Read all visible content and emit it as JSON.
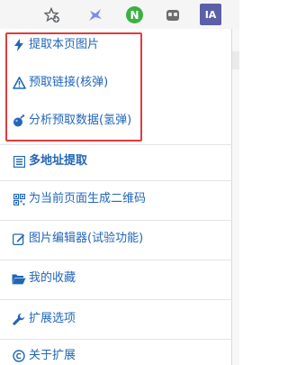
{
  "toolbar": {
    "extensions": [
      {
        "icon": "bookmark-add-icon"
      },
      {
        "icon": "extension-bird-icon",
        "color": "#7c8cf0"
      },
      {
        "icon": "n-extension-icon",
        "label": "N",
        "color": "#3cb043"
      },
      {
        "icon": "gamepad-extension-icon"
      },
      {
        "icon": "ia-extension-icon",
        "label": "IA",
        "color": "#5b5fa8"
      }
    ]
  },
  "menu": {
    "highlight_color": "#e23b3b",
    "link_color": "#2266b8",
    "items": [
      {
        "icon": "lightning-icon",
        "label": "提取本页图片"
      },
      {
        "icon": "warning-triangle-icon",
        "label": "预取链接(核弹)"
      },
      {
        "icon": "bomb-icon",
        "label": "分析预取数据(氢弹)"
      },
      {
        "icon": "list-icon",
        "label": "多地址提取"
      },
      {
        "icon": "qrcode-icon",
        "label": "为当前页面生成二维码"
      },
      {
        "icon": "edit-icon",
        "label": "图片编辑器(试验功能)"
      },
      {
        "icon": "folder-open-icon",
        "label": "我的收藏"
      },
      {
        "icon": "wrench-icon",
        "label": "扩展选项"
      },
      {
        "icon": "copyright-icon",
        "label": "关于扩展"
      }
    ]
  }
}
